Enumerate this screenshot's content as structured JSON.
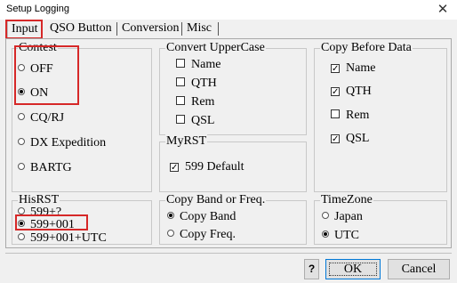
{
  "window": {
    "title": "Setup Logging",
    "close_glyph": "✕"
  },
  "tabs": [
    {
      "label": "Input",
      "active": true
    },
    {
      "label": "QSO Button",
      "active": false
    },
    {
      "label": "Conversion",
      "active": false
    },
    {
      "label": "Misc",
      "active": false
    }
  ],
  "contest": {
    "label": "Contest",
    "options": [
      {
        "label": "OFF",
        "selected": false
      },
      {
        "label": "ON",
        "selected": true
      },
      {
        "label": "CQ/RJ",
        "selected": false
      },
      {
        "label": "DX Expedition",
        "selected": false
      },
      {
        "label": "BARTG",
        "selected": false
      }
    ]
  },
  "convert_uppercase": {
    "label": "Convert UpperCase",
    "items": [
      {
        "label": "Name",
        "checked": false
      },
      {
        "label": "QTH",
        "checked": false
      },
      {
        "label": "Rem",
        "checked": false
      },
      {
        "label": "QSL",
        "checked": false
      }
    ]
  },
  "copy_before": {
    "label": "Copy Before Data",
    "items": [
      {
        "label": "Name",
        "checked": true
      },
      {
        "label": "QTH",
        "checked": true
      },
      {
        "label": "Rem",
        "checked": false
      },
      {
        "label": "QSL",
        "checked": true
      }
    ]
  },
  "myrst": {
    "label": "MyRST",
    "items": [
      {
        "label": "599 Default",
        "checked": true
      }
    ]
  },
  "hisrst": {
    "label": "HisRST",
    "options": [
      {
        "label": "599+?",
        "selected": false
      },
      {
        "label": "599+001",
        "selected": true
      },
      {
        "label": "599+001+UTC",
        "selected": false
      }
    ]
  },
  "copy_band": {
    "label": "Copy Band or Freq.",
    "options": [
      {
        "label": "Copy Band",
        "selected": true
      },
      {
        "label": "Copy Freq.",
        "selected": false
      }
    ]
  },
  "timezone": {
    "label": "TimeZone",
    "options": [
      {
        "label": "Japan",
        "selected": false
      },
      {
        "label": "UTC",
        "selected": true
      }
    ]
  },
  "buttons": {
    "help": "?",
    "ok": "OK",
    "cancel": "Cancel"
  },
  "colors": {
    "highlight": "#d62828",
    "window_bg": "#f0f0f0"
  }
}
